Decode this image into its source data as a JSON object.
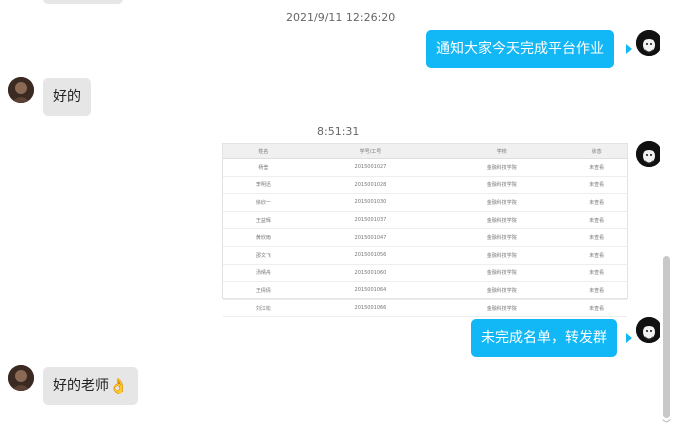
{
  "messages": {
    "top_time": "2021/9/11 12:26:20",
    "msg1": "通知大家今天完成平台作业",
    "msg2": "好的",
    "time2": "8:51:31",
    "msg3": "未完成名单，转发群",
    "msg4_text": "好的老师",
    "msg4_emoji": "👌"
  },
  "shot_table": {
    "headers": [
      "姓名",
      "学号/工号",
      "学校",
      "状态"
    ],
    "rows": [
      [
        "杨莹",
        "2015001027",
        "金融科技学院",
        "未查看"
      ],
      [
        "李明迅",
        "2015001028",
        "金融科技学院",
        "未查看"
      ],
      [
        "徐欣一",
        "2015001030",
        "金融科技学院",
        "未查看"
      ],
      [
        "王益辉",
        "2015001037",
        "金融科技学院",
        "未查看"
      ],
      [
        "黄欣雨",
        "2015001047",
        "金融科技学院",
        "未查看"
      ],
      [
        "邵文飞",
        "2015001056",
        "金融科技学院",
        "未查看"
      ],
      [
        "汤晴舟",
        "2015001060",
        "金融科技学院",
        "未查看"
      ],
      [
        "王倩倩",
        "2015001064",
        "金融科技学院",
        "未查看"
      ],
      [
        "刘江松",
        "2015001066",
        "金融科技学院",
        "未查看"
      ]
    ]
  },
  "colors": {
    "sent_bubble": "#12b7f5",
    "recv_bubble": "#e6e6e6"
  }
}
